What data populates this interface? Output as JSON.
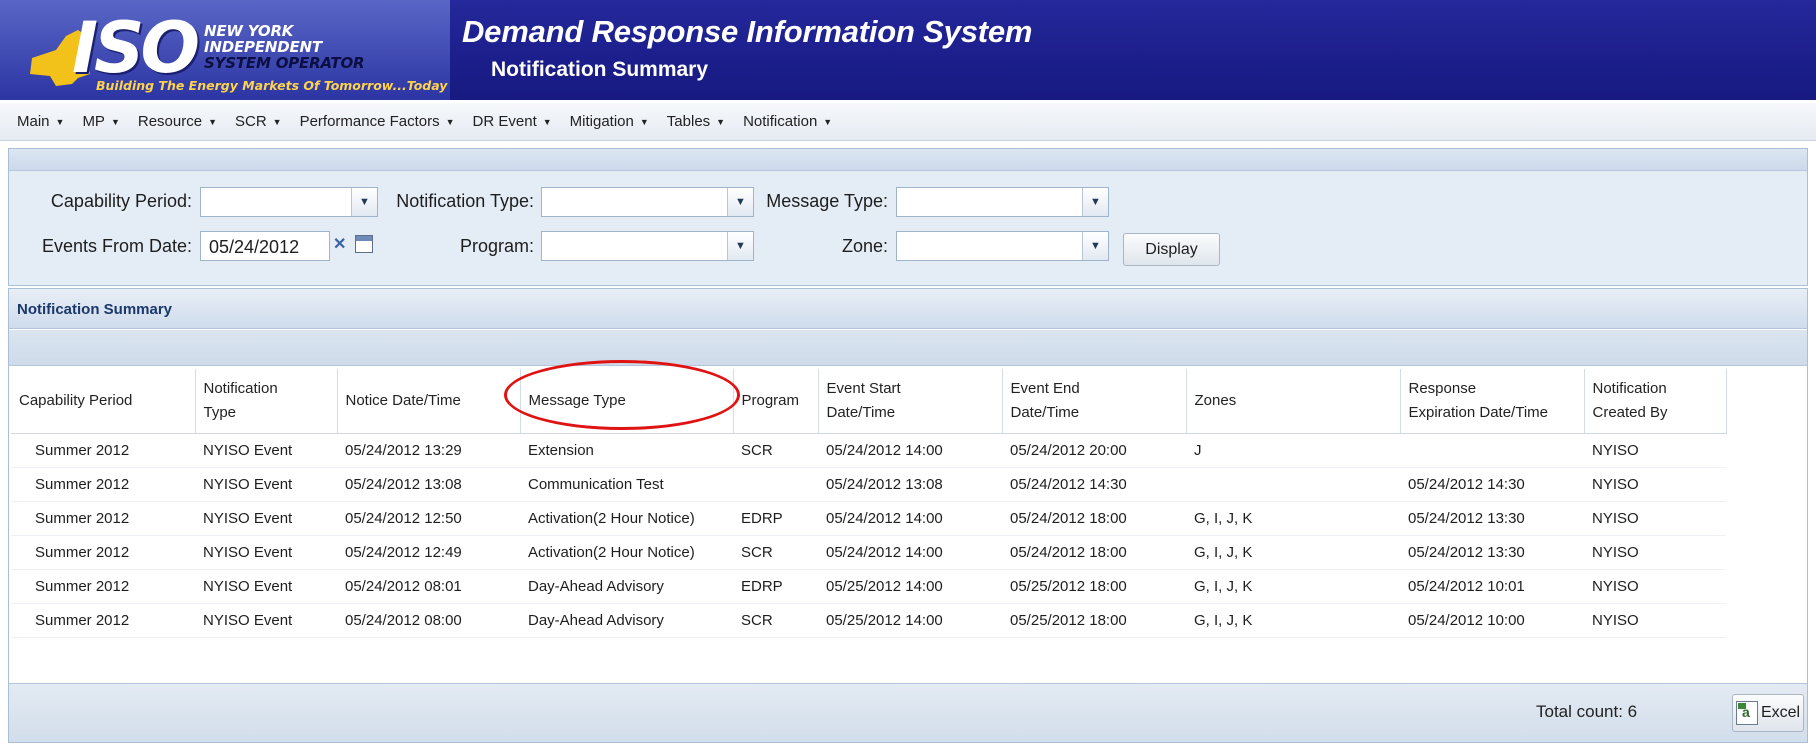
{
  "header": {
    "logo": {
      "mark": "ISO",
      "line1": "NEW YORK",
      "line2": "INDEPENDENT",
      "line3": "SYSTEM OPERATOR",
      "tagline": "Building The Energy Markets Of Tomorrow...Today"
    },
    "title": "Demand Response Information System",
    "subtitle": "Notification Summary"
  },
  "menu": [
    {
      "label": "Main"
    },
    {
      "label": "MP"
    },
    {
      "label": "Resource"
    },
    {
      "label": "SCR"
    },
    {
      "label": "Performance Factors"
    },
    {
      "label": "DR Event"
    },
    {
      "label": "Mitigation"
    },
    {
      "label": "Tables"
    },
    {
      "label": "Notification"
    }
  ],
  "filters": {
    "capability_period": {
      "label": "Capability Period:",
      "value": ""
    },
    "notification_type": {
      "label": "Notification Type:",
      "value": ""
    },
    "message_type": {
      "label": "Message Type:",
      "value": ""
    },
    "events_from_date": {
      "label": "Events From Date:",
      "value": "05/24/2012"
    },
    "program": {
      "label": "Program:",
      "value": ""
    },
    "zone": {
      "label": "Zone:",
      "value": ""
    },
    "display_button": "Display"
  },
  "grid": {
    "title": "Notification Summary",
    "columns": [
      {
        "line1": "Capability Period",
        "line2": ""
      },
      {
        "line1": "Notification",
        "line2": "Type"
      },
      {
        "line1": "Notice Date/Time",
        "line2": ""
      },
      {
        "line1": "Message Type",
        "line2": ""
      },
      {
        "line1": "Program",
        "line2": ""
      },
      {
        "line1": "Event Start",
        "line2": "Date/Time"
      },
      {
        "line1": "Event End",
        "line2": "Date/Time"
      },
      {
        "line1": "Zones",
        "line2": ""
      },
      {
        "line1": "Response",
        "line2": "Expiration Date/Time"
      },
      {
        "line1": "Notification",
        "line2": "Created By"
      }
    ],
    "rows": [
      [
        "Summer 2012",
        "NYISO Event",
        "05/24/2012 13:29",
        "Extension",
        "SCR",
        "05/24/2012 14:00",
        "05/24/2012 20:00",
        "J",
        "",
        "NYISO"
      ],
      [
        "Summer 2012",
        "NYISO Event",
        "05/24/2012 13:08",
        "Communication Test",
        "",
        "05/24/2012 13:08",
        "05/24/2012 14:30",
        "",
        "05/24/2012 14:30",
        "NYISO"
      ],
      [
        "Summer 2012",
        "NYISO Event",
        "05/24/2012 12:50",
        "Activation(2 Hour Notice)",
        "EDRP",
        "05/24/2012 14:00",
        "05/24/2012 18:00",
        "G, I, J, K",
        "05/24/2012 13:30",
        "NYISO"
      ],
      [
        "Summer 2012",
        "NYISO Event",
        "05/24/2012 12:49",
        "Activation(2 Hour Notice)",
        "SCR",
        "05/24/2012 14:00",
        "05/24/2012 18:00",
        "G, I, J, K",
        "05/24/2012 13:30",
        "NYISO"
      ],
      [
        "Summer 2012",
        "NYISO Event",
        "05/24/2012 08:01",
        "Day-Ahead Advisory",
        "EDRP",
        "05/25/2012 14:00",
        "05/25/2012 18:00",
        "G, I, J, K",
        "05/24/2012 10:01",
        "NYISO"
      ],
      [
        "Summer 2012",
        "NYISO Event",
        "05/24/2012 08:00",
        "Day-Ahead Advisory",
        "SCR",
        "05/25/2012 14:00",
        "05/25/2012 18:00",
        "G, I, J, K",
        "05/24/2012 10:00",
        "NYISO"
      ]
    ],
    "total_count": "Total count: 6",
    "excel_button": "Excel"
  },
  "colors": {
    "header_bg": "#1c1f8c",
    "panel_bg": "#e4ecf6",
    "highlight": "#e01313",
    "grid_title": "#19386b"
  }
}
